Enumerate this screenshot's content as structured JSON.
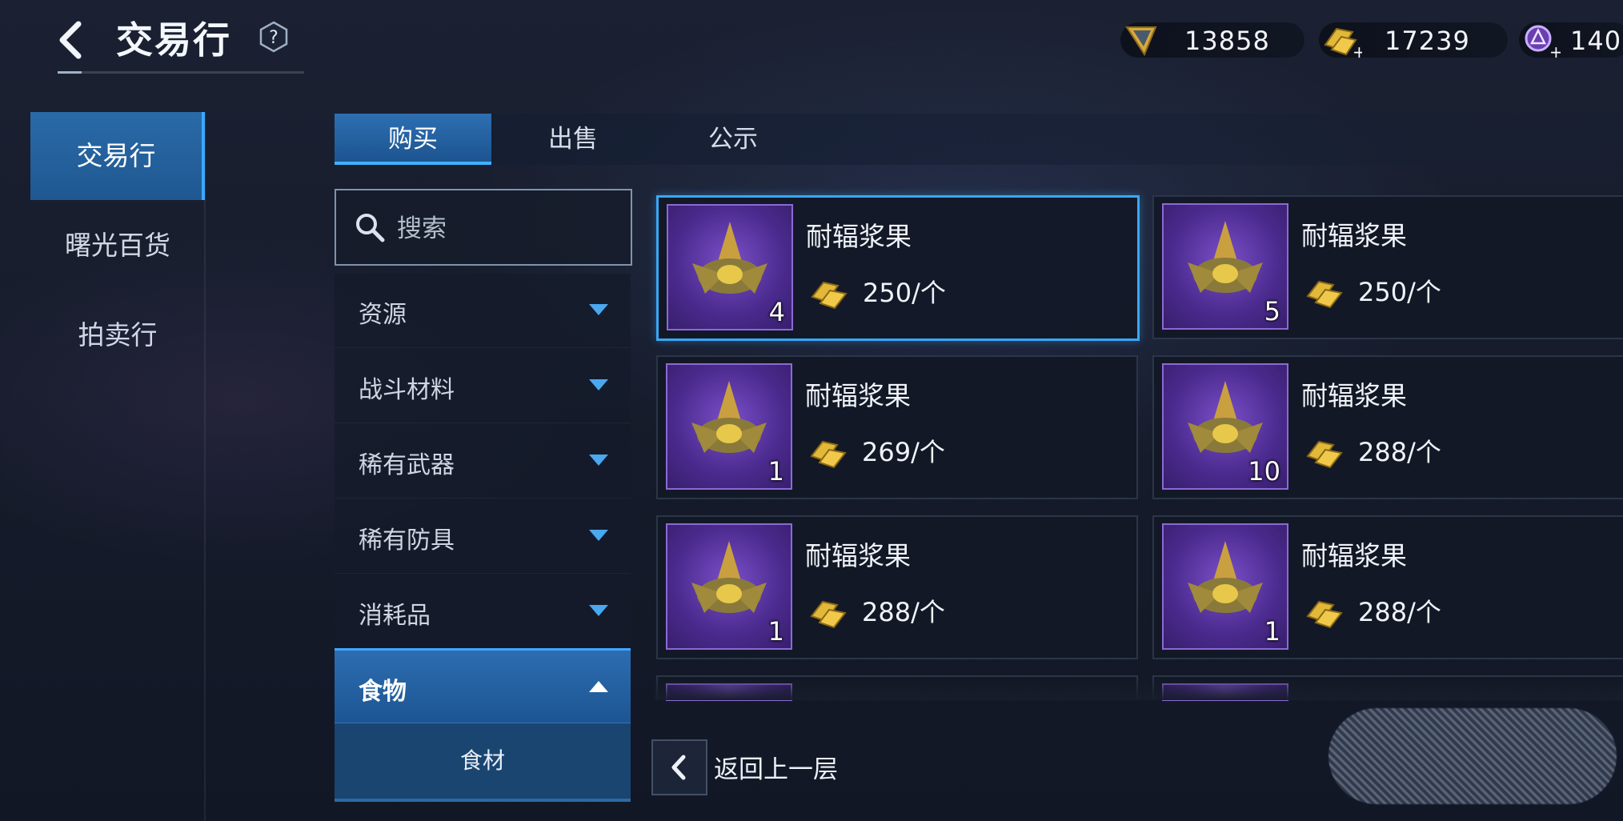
{
  "header": {
    "title": "交易行",
    "help_label": "?",
    "currencies": [
      {
        "icon": "voucher-currency-icon",
        "value": "13858"
      },
      {
        "icon": "gold-bar-currency-icon",
        "value": "17239"
      },
      {
        "icon": "crystal-currency-icon",
        "value": "140"
      }
    ]
  },
  "sidebar": {
    "items": [
      {
        "label": "交易行",
        "active": true
      },
      {
        "label": "曙光百货",
        "active": false
      },
      {
        "label": "拍卖行",
        "active": false
      }
    ]
  },
  "tabs": [
    {
      "label": "购买",
      "active": true
    },
    {
      "label": "出售",
      "active": false
    },
    {
      "label": "公示",
      "active": false
    }
  ],
  "search": {
    "placeholder": "搜索"
  },
  "categories": [
    {
      "label": "资源",
      "expanded": false
    },
    {
      "label": "战斗材料",
      "expanded": false
    },
    {
      "label": "稀有武器",
      "expanded": false
    },
    {
      "label": "稀有防具",
      "expanded": false
    },
    {
      "label": "消耗品",
      "expanded": false
    },
    {
      "label": "食物",
      "expanded": true
    }
  ],
  "subcategory": {
    "label": "食材"
  },
  "listings": [
    {
      "name": "耐辐浆果",
      "qty": "4",
      "price": "250/个",
      "selected": true
    },
    {
      "name": "耐辐浆果",
      "qty": "5",
      "price": "250/个",
      "selected": false
    },
    {
      "name": "耐辐浆果",
      "qty": "1",
      "price": "269/个",
      "selected": false
    },
    {
      "name": "耐辐浆果",
      "qty": "10",
      "price": "288/个",
      "selected": false
    },
    {
      "name": "耐辐浆果",
      "qty": "1",
      "price": "288/个",
      "selected": false
    },
    {
      "name": "耐辐浆果",
      "qty": "1",
      "price": "288/个",
      "selected": false
    }
  ],
  "footer": {
    "back_label": "返回上一层"
  },
  "colors": {
    "accent": "#3aa7f5",
    "item_rarity_purple": "#5b34a8",
    "gold": "#e2b83a"
  }
}
